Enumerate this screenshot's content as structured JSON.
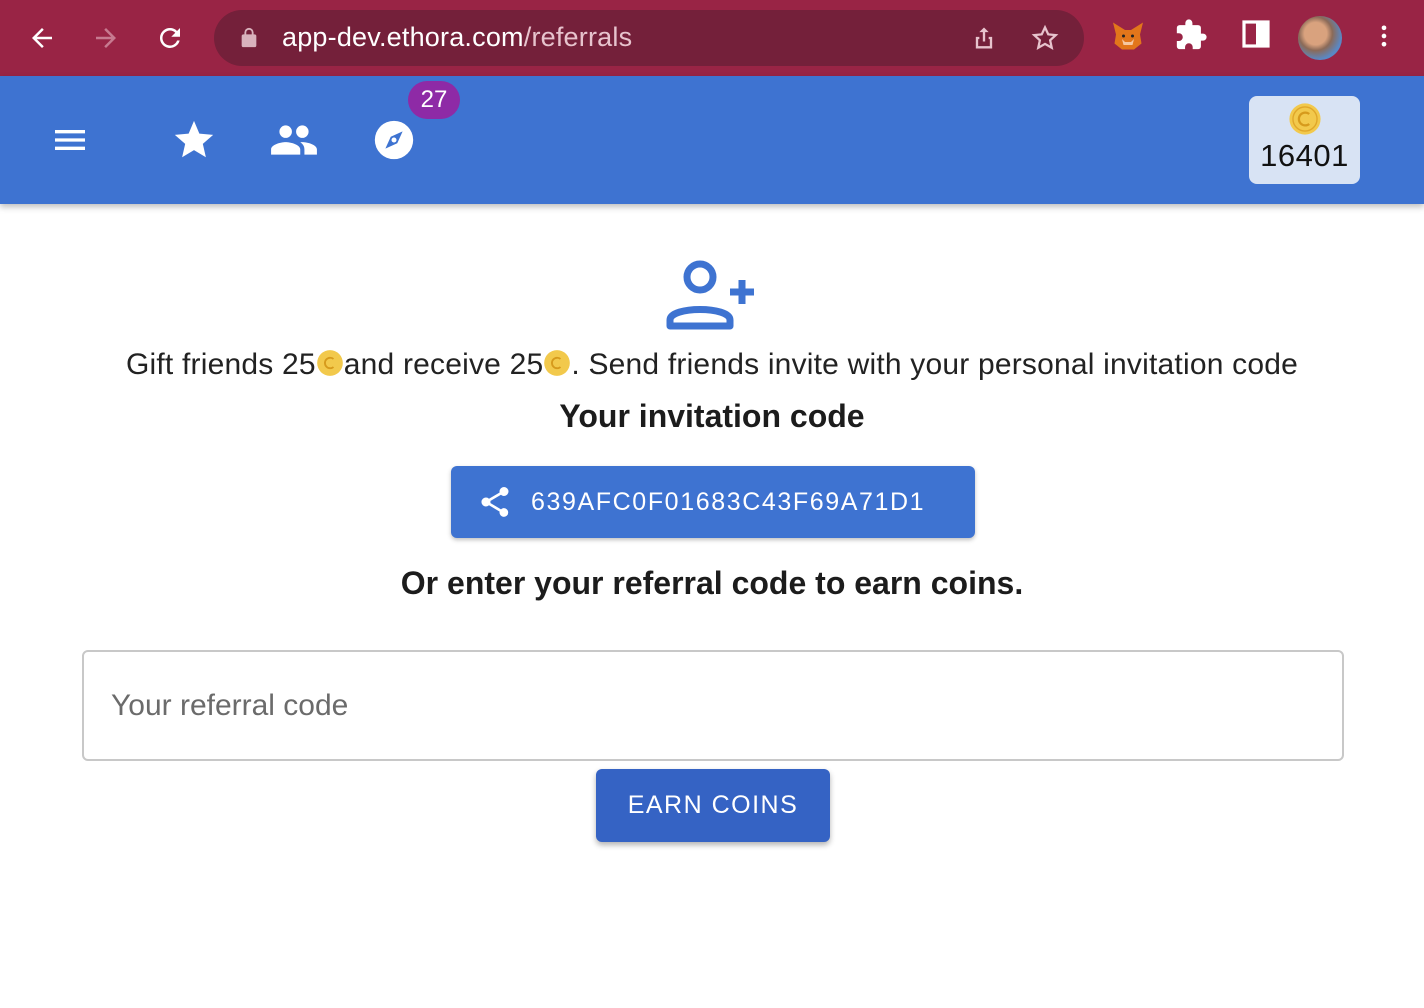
{
  "browser": {
    "url_host": "app-dev.ethora.com",
    "url_path": "/referrals"
  },
  "appbar": {
    "notification_count": "27",
    "coin_balance": "16401"
  },
  "referral": {
    "gift_text_1": "Gift friends 25",
    "gift_text_2": "and receive 25",
    "gift_text_3": ". Send friends invite with your personal invitation code",
    "invite_title": "Your invitation code",
    "invitation_code": "639AFC0F01683C43F69A71D1",
    "or_text": "Or enter your referral code to earn coins.",
    "input_placeholder": "Your referral code",
    "earn_button_label": "EARN COINS"
  },
  "colors": {
    "chrome_bg": "#992445",
    "appbar_bg": "#3e73d1",
    "accent": "#3e73d1",
    "badge": "#8e2aa6",
    "coin": "#f2c94c"
  }
}
